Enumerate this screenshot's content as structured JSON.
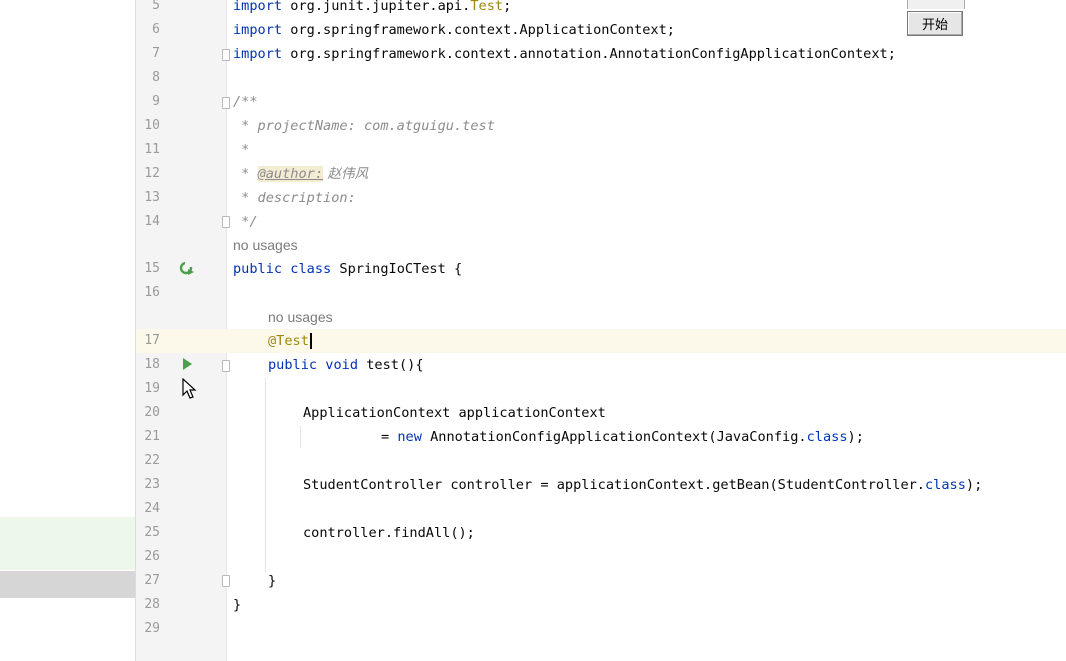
{
  "editor": {
    "line_numbers": [
      "5",
      "6",
      "7",
      "8",
      "9",
      "10",
      "11",
      "12",
      "13",
      "14",
      "15",
      "16",
      "17",
      "18",
      "19",
      "20",
      "21",
      "22",
      "23",
      "24",
      "25",
      "26",
      "27",
      "28",
      "29"
    ],
    "imports": {
      "line5_kw": "import",
      "line5_pkg": " org.junit.jupiter.api.",
      "line5_cls": "Test",
      "line5_end": ";",
      "line6_kw": "import",
      "line6_rest": " org.springframework.context.ApplicationContext;",
      "line7_kw": "import",
      "line7_rest": " org.springframework.context.annotation.AnnotationConfigApplicationContext;"
    },
    "javadoc": {
      "open": "/**",
      "project_line": " * projectName: com.atguigu.test",
      "blank_line": " *",
      "author_prefix": " * ",
      "author_tag": "@author:",
      "author_name": " 赵伟风",
      "description_line": " * description:",
      "close": " */"
    },
    "usage_hint_class": "no usages",
    "class_decl": {
      "kw": "public class",
      "rest": " SpringIoCTest {"
    },
    "usage_hint_method": "no usages",
    "annotation": "@Test",
    "method_decl": {
      "kw": "public void",
      "rest": " test(){"
    },
    "line20": "ApplicationContext applicationContext",
    "line21_eq": "= ",
    "line21_new": "new",
    "line21_rest": " AnnotationConfigApplicationContext(JavaConfig.",
    "line21_class": "class",
    "line21_end": ");",
    "line23_pre": "StudentController controller = applicationContext.getBean(StudentController.",
    "line23_class": "class",
    "line23_end": ");",
    "line25": "controller.findAll();",
    "line27": "}",
    "line28": "}"
  },
  "overlay": {
    "start_button_label": "开始"
  },
  "colors": {
    "keyword": "#0033b3",
    "annotation": "#9e880d",
    "comment": "#8c8c8c",
    "current_line": "#fcf9ea",
    "run_icon": "#4c9f4c"
  }
}
